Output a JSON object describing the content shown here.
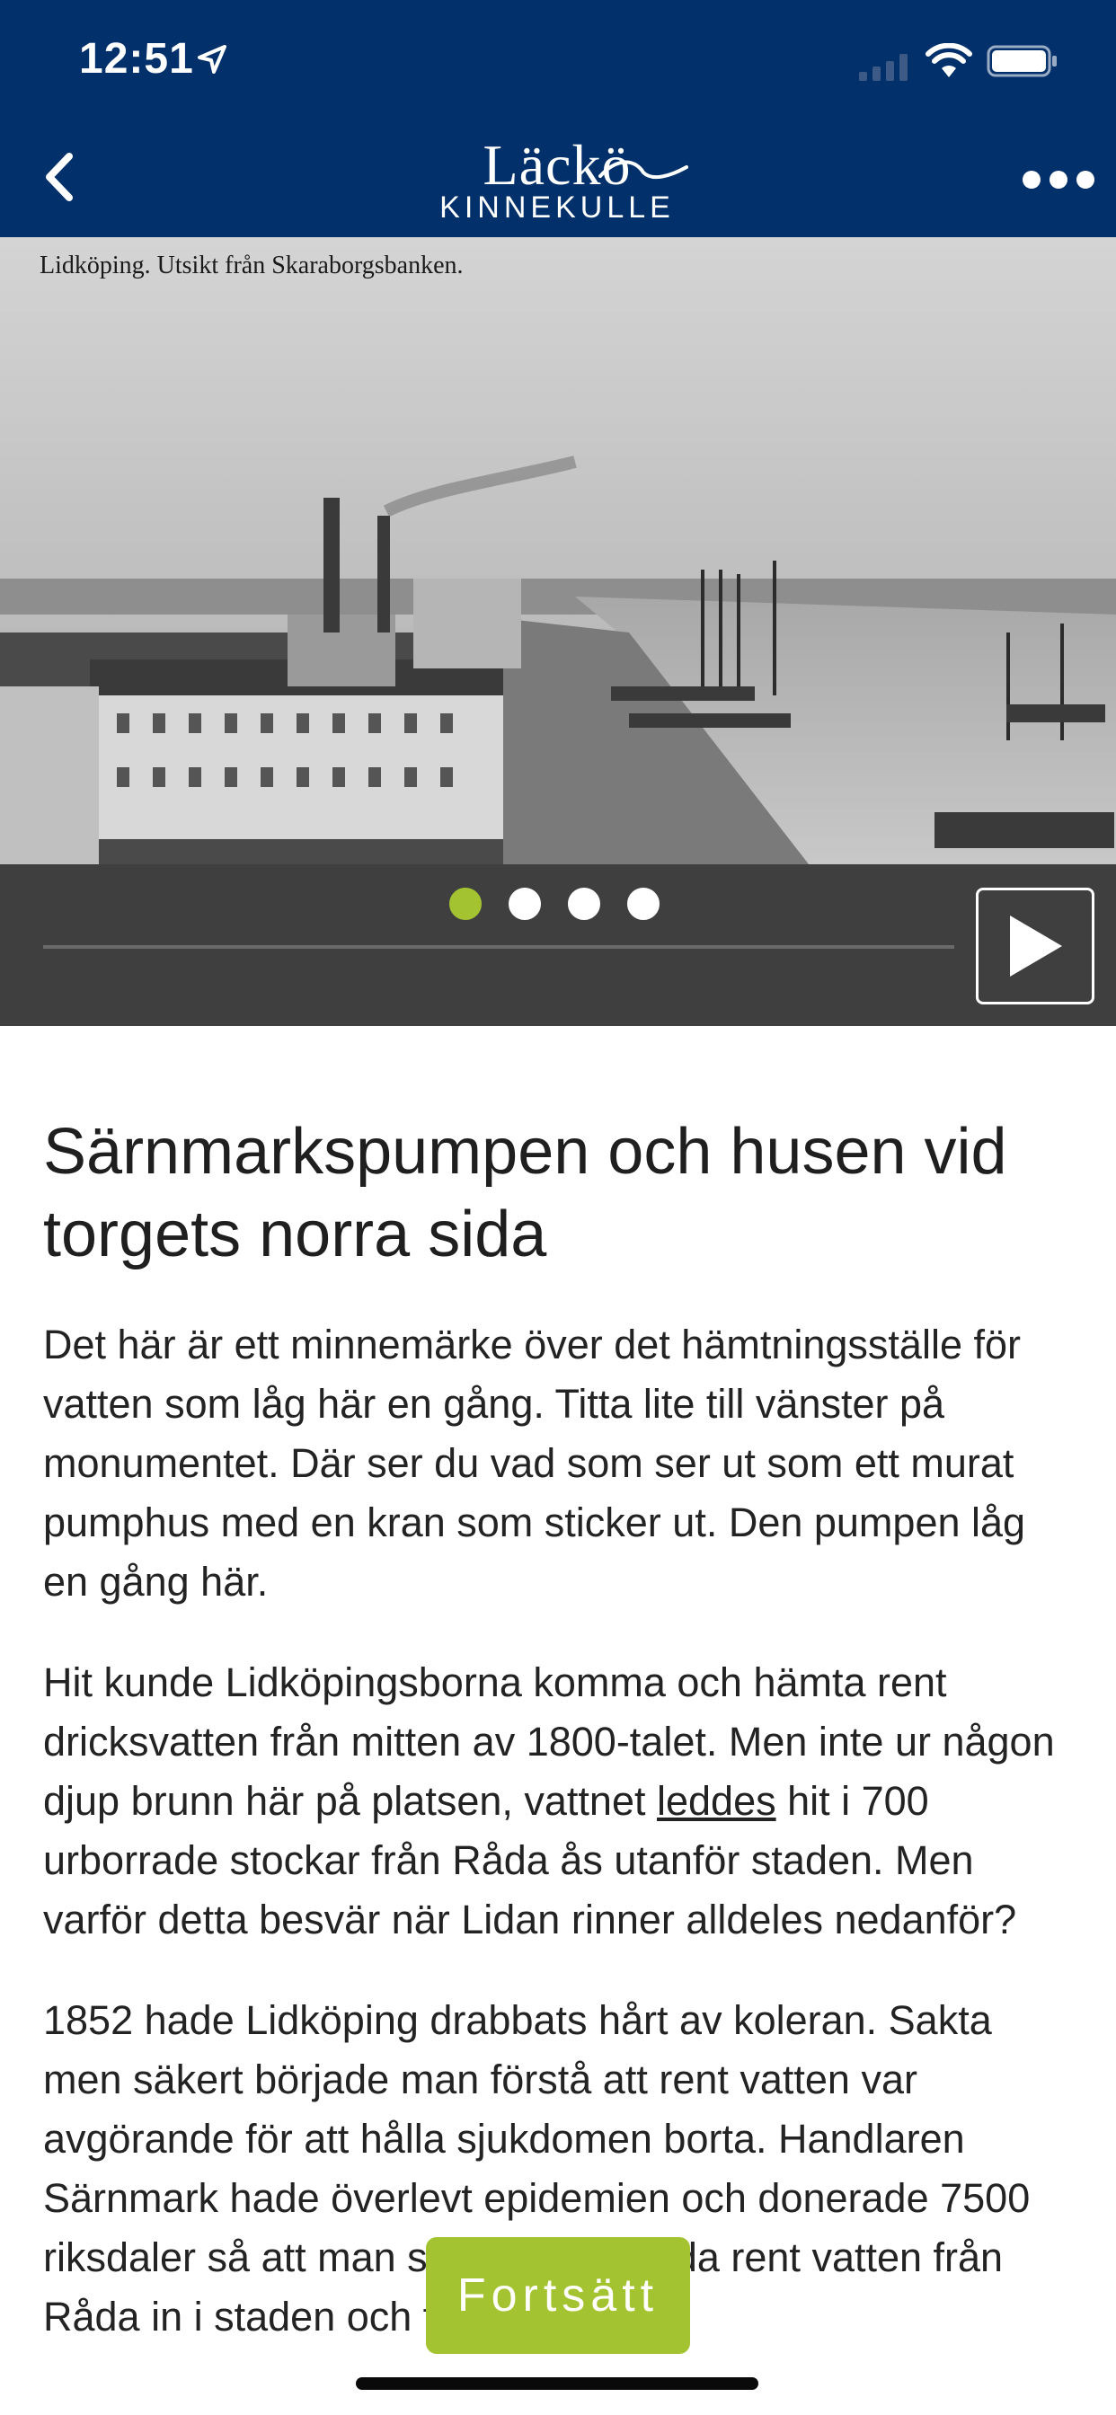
{
  "status_bar": {
    "time": "12:51",
    "icons": [
      "location-arrow-icon",
      "signal-icon",
      "wifi-icon",
      "battery-icon"
    ]
  },
  "nav": {
    "logo_top": "Läckö",
    "logo_bottom": "KINNEKULLE",
    "back_icon": "chevron-left-icon",
    "more_icon": "ellipsis-icon"
  },
  "hero": {
    "caption": "Lidköping.  Utsikt från Skaraborgsbanken."
  },
  "media": {
    "slides": 4,
    "active_slide": 1,
    "progress": 0,
    "play_icon": "play-icon"
  },
  "article": {
    "title": "Särnmarkspumpen och husen vid torgets norra sida",
    "p1": "Det här är ett minnemärke över det hämtningsställe för vatten som låg här en gång. Titta lite till vänster på monumentet. Där ser du vad som ser ut som ett murat pumphus med en kran som sticker ut. Den pumpen låg en gång här.",
    "p2_before": "Hit kunde Lidköpingsborna komma och hämta rent dricksvatten från mitten av 1800-talet. Men inte ur någon djup brunn här på platsen, vattnet ",
    "p2_link": "leddes",
    "p2_after": " hit i 700 urborrade stockar från Råda ås utanför staden. Men varför detta besvär när Lidan rinner alldeles nedanför?",
    "p3": "1852 hade Lidköping drabbats hårt av koleran. Sakta men säkert började man förstå att rent vatten var avgörande för att hålla sjukdomen borta. Handlaren Särnmark hade överlevt epidemien och donerade 7500 riksdaler så att man skulle kunna leda rent vatten från Råda in i staden och till den"
  },
  "continue_button": {
    "label": "Fortsätt"
  },
  "colors": {
    "header": "#02306b",
    "accent": "#a4c331",
    "media_bar": "#3f3f3f"
  }
}
